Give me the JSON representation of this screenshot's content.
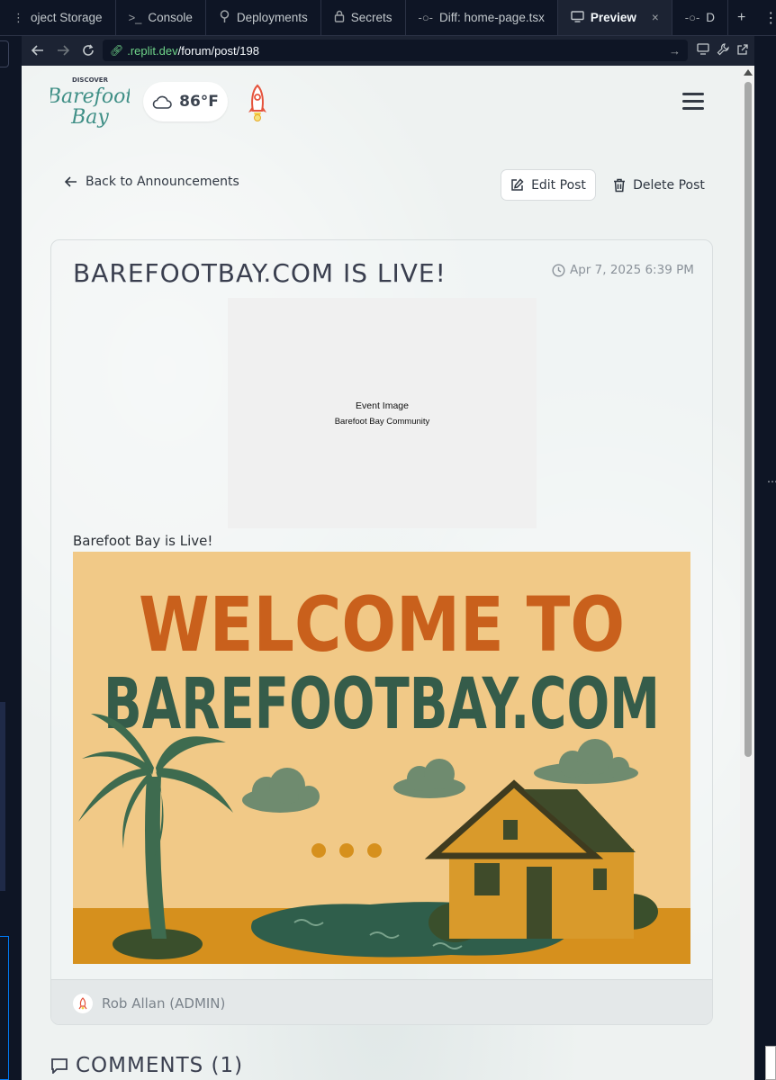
{
  "tabs": [
    {
      "label": "oject Storage",
      "icon": "more-vert-icon"
    },
    {
      "label": "Console",
      "icon": "terminal-icon"
    },
    {
      "label": "Deployments",
      "icon": "deployments-icon"
    },
    {
      "label": "Secrets",
      "icon": "lock-icon"
    },
    {
      "label": "Diff: home-page.tsx",
      "icon": "git-commit-icon"
    },
    {
      "label": "Preview",
      "icon": "monitor-icon",
      "active": true
    },
    {
      "label": "D",
      "icon": "git-commit-icon"
    }
  ],
  "address": {
    "domain": ".replit.dev",
    "path": "/forum/post/198"
  },
  "site": {
    "logo": {
      "top": "DISCOVER",
      "line1": "Barefoot",
      "line2": "Bay"
    },
    "weather": {
      "temp": "86°F",
      "icon": "cloud-icon"
    },
    "back_label": "Back to Announcements",
    "edit_label": "Edit Post",
    "delete_label": "Delete Post"
  },
  "post": {
    "title": "BAREFOOTBAY.COM IS LIVE!",
    "date": "Apr 7, 2025 6:39 PM",
    "event_image": {
      "title": "Event Image",
      "subtitle": "Barefoot Bay Community"
    },
    "body": "Barefoot Bay is Live!",
    "banner": {
      "line1": "WELCOME TO",
      "line2": "BAREFOOTBAY.COM"
    },
    "author": "Rob Allan (ADMIN)"
  },
  "comments": {
    "heading": "COMMENTS (1)"
  },
  "colors": {
    "accent_orange": "#c9601c",
    "accent_green": "#355c4a",
    "banner_bg": "#f1c987"
  }
}
